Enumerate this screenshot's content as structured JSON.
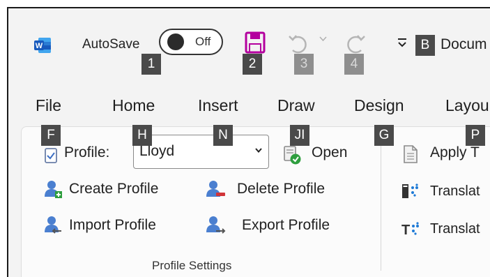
{
  "titlebar": {
    "autosave_label": "AutoSave",
    "autosave_state": "Off",
    "document_title": "Docum"
  },
  "keytips": {
    "autosave": "1",
    "save": "2",
    "undo": "3",
    "redo": "4",
    "customize_qat": "B",
    "file": "F",
    "home": "H",
    "insert": "N",
    "draw": "JI",
    "design": "G",
    "layout": "P"
  },
  "tabs": {
    "file": "File",
    "home": "Home",
    "insert": "Insert",
    "draw": "Draw",
    "design": "Design",
    "layout": "Layou"
  },
  "ribbon": {
    "profile_label": "Profile:",
    "profile_value": "Lloyd",
    "open_label": "Open",
    "create_profile": "Create Profile",
    "delete_profile": "Delete Profile",
    "import_profile": "Import Profile",
    "export_profile": "Export  Profile",
    "group_label": "Profile Settings",
    "apply_label": "Apply T",
    "translate1_label": "Translat",
    "translate2_label": "Translat"
  },
  "colors": {
    "keytip_bg": "#4a4a4a",
    "word_blue": "#185abd",
    "save_purple": "#b4009e",
    "open_green": "#2e9e3e"
  }
}
